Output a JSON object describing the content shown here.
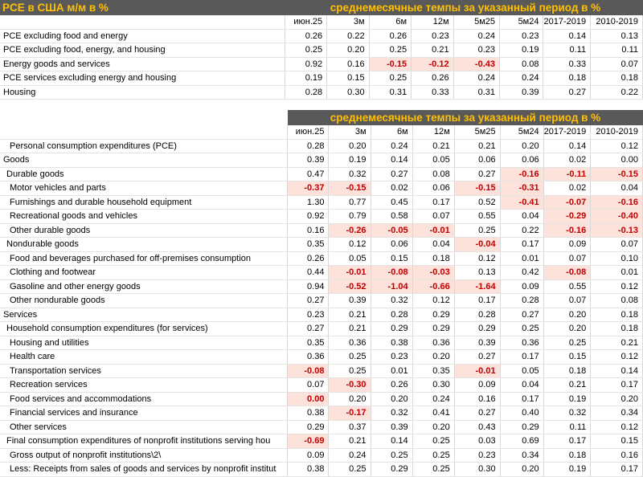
{
  "title": "PCE в США м/м в %",
  "band_title": "среднемесячные темпы за указанный период в %",
  "columns": [
    "июн.25",
    "3м",
    "6м",
    "12м",
    "5м25",
    "5м24",
    "2017-2019",
    "2010-2019"
  ],
  "table1": [
    {
      "label": "PCE excluding food and energy",
      "values": [
        "0.26",
        "0.22",
        "0.26",
        "0.23",
        "0.24",
        "0.23",
        "0.14",
        "0.13"
      ]
    },
    {
      "label": "PCE excluding food, energy, and housing",
      "values": [
        "0.25",
        "0.20",
        "0.25",
        "0.21",
        "0.23",
        "0.19",
        "0.11",
        "0.11"
      ]
    },
    {
      "label": "Energy goods and services",
      "values": [
        "0.92",
        "0.16",
        "-0.15",
        "-0.12",
        "-0.43",
        "0.08",
        "0.33",
        "0.07"
      ]
    },
    {
      "label": "PCE services excluding energy and housing",
      "values": [
        "0.19",
        "0.15",
        "0.25",
        "0.26",
        "0.24",
        "0.24",
        "0.18",
        "0.18"
      ]
    },
    {
      "label": "Housing",
      "values": [
        "0.28",
        "0.30",
        "0.31",
        "0.33",
        "0.31",
        "0.39",
        "0.27",
        "0.22"
      ]
    }
  ],
  "table2": [
    {
      "label": "Personal consumption expenditures (PCE)",
      "indent": 2,
      "values": [
        "0.28",
        "0.20",
        "0.24",
        "0.21",
        "0.21",
        "0.20",
        "0.14",
        "0.12"
      ]
    },
    {
      "label": "Goods",
      "indent": 0,
      "values": [
        "0.39",
        "0.19",
        "0.14",
        "0.05",
        "0.06",
        "0.06",
        "0.02",
        "0.00"
      ]
    },
    {
      "label": "Durable goods",
      "indent": 1,
      "values": [
        "0.47",
        "0.32",
        "0.27",
        "0.08",
        "0.27",
        "-0.16",
        "-0.11",
        "-0.15"
      ]
    },
    {
      "label": "Motor vehicles and parts",
      "indent": 2,
      "values": [
        "-0.37",
        "-0.15",
        "0.02",
        "0.06",
        "-0.15",
        "-0.31",
        "0.02",
        "0.04"
      ]
    },
    {
      "label": "Furnishings and durable household equipment",
      "indent": 2,
      "values": [
        "1.30",
        "0.77",
        "0.45",
        "0.17",
        "0.52",
        "-0.41",
        "-0.07",
        "-0.16"
      ]
    },
    {
      "label": "Recreational goods and vehicles",
      "indent": 2,
      "values": [
        "0.92",
        "0.79",
        "0.58",
        "0.07",
        "0.55",
        "0.04",
        "-0.29",
        "-0.40"
      ]
    },
    {
      "label": "Other durable goods",
      "indent": 2,
      "values": [
        "0.16",
        "-0.26",
        "-0.05",
        "-0.01",
        "0.25",
        "0.22",
        "-0.16",
        "-0.13"
      ]
    },
    {
      "label": "Nondurable goods",
      "indent": 1,
      "values": [
        "0.35",
        "0.12",
        "0.06",
        "0.04",
        "-0.04",
        "0.17",
        "0.09",
        "0.07"
      ]
    },
    {
      "label": "Food and beverages purchased for off-premises consumption",
      "indent": 2,
      "values": [
        "0.26",
        "0.05",
        "0.15",
        "0.18",
        "0.12",
        "0.01",
        "0.07",
        "0.10"
      ]
    },
    {
      "label": "Clothing and footwear",
      "indent": 2,
      "values": [
        "0.44",
        "-0.01",
        "-0.08",
        "-0.03",
        "0.13",
        "0.42",
        "-0.08",
        "0.01"
      ]
    },
    {
      "label": "Gasoline and other energy goods",
      "indent": 2,
      "values": [
        "0.94",
        "-0.52",
        "-1.04",
        "-0.66",
        "-1.64",
        "0.09",
        "0.55",
        "0.12"
      ]
    },
    {
      "label": "Other nondurable goods",
      "indent": 2,
      "values": [
        "0.27",
        "0.39",
        "0.32",
        "0.12",
        "0.17",
        "0.28",
        "0.07",
        "0.08"
      ]
    },
    {
      "label": "Services",
      "indent": 0,
      "values": [
        "0.23",
        "0.21",
        "0.28",
        "0.29",
        "0.28",
        "0.27",
        "0.20",
        "0.18"
      ]
    },
    {
      "label": "Household consumption expenditures (for services)",
      "indent": 1,
      "values": [
        "0.27",
        "0.21",
        "0.29",
        "0.29",
        "0.29",
        "0.25",
        "0.20",
        "0.18"
      ]
    },
    {
      "label": "Housing and utilities",
      "indent": 2,
      "values": [
        "0.35",
        "0.36",
        "0.38",
        "0.36",
        "0.39",
        "0.36",
        "0.25",
        "0.21"
      ]
    },
    {
      "label": "Health care",
      "indent": 2,
      "values": [
        "0.36",
        "0.25",
        "0.23",
        "0.20",
        "0.27",
        "0.17",
        "0.15",
        "0.12"
      ]
    },
    {
      "label": "Transportation services",
      "indent": 2,
      "values": [
        "-0.08",
        "0.25",
        "0.01",
        "0.35",
        "-0.01",
        "0.05",
        "0.18",
        "0.14"
      ]
    },
    {
      "label": "Recreation services",
      "indent": 2,
      "values": [
        "0.07",
        "-0.30",
        "0.26",
        "0.30",
        "0.09",
        "0.04",
        "0.21",
        "0.17"
      ]
    },
    {
      "label": "Food services and accommodations",
      "indent": 2,
      "values": [
        "0.00",
        "0.20",
        "0.20",
        "0.24",
        "0.16",
        "0.17",
        "0.19",
        "0.20"
      ]
    },
    {
      "label": "Financial services and insurance",
      "indent": 2,
      "values": [
        "0.38",
        "-0.17",
        "0.32",
        "0.41",
        "0.27",
        "0.40",
        "0.32",
        "0.34"
      ]
    },
    {
      "label": "Other services",
      "indent": 2,
      "values": [
        "0.29",
        "0.37",
        "0.39",
        "0.20",
        "0.43",
        "0.29",
        "0.11",
        "0.12"
      ]
    },
    {
      "label": "Final consumption expenditures of nonprofit institutions serving hou",
      "indent": 1,
      "values": [
        "-0.69",
        "0.21",
        "0.14",
        "0.25",
        "0.03",
        "0.69",
        "0.17",
        "0.15"
      ]
    },
    {
      "label": "Gross output of nonprofit institutions\\2\\",
      "indent": 2,
      "values": [
        "0.09",
        "0.24",
        "0.25",
        "0.25",
        "0.23",
        "0.34",
        "0.18",
        "0.16"
      ]
    },
    {
      "label": "Less: Receipts from sales of goods and services by nonprofit institut",
      "indent": 2,
      "values": [
        "0.38",
        "0.25",
        "0.29",
        "0.25",
        "0.30",
        "0.20",
        "0.19",
        "0.17"
      ]
    }
  ],
  "colors": {
    "header_bg": "#595959",
    "header_text": "#ffc000",
    "negative_bg": "#fde2dc",
    "negative_text": "#c00000"
  }
}
